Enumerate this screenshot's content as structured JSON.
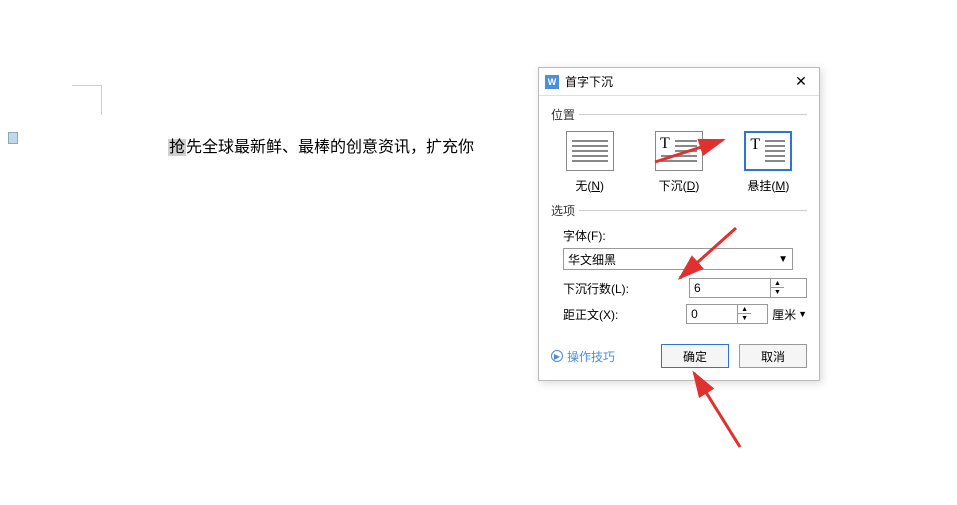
{
  "document": {
    "body_text": "抢先全球最新鲜、最棒的创意资讯，扩充你",
    "cursor_initial": "抢"
  },
  "dialog": {
    "title": "首字下沉",
    "icon_glyph": "W",
    "section_position": "位置",
    "section_options": "选项",
    "position_options": [
      {
        "label_prefix": "无(",
        "key": "N",
        "label_suffix": ")"
      },
      {
        "label_prefix": "下沉(",
        "key": "D",
        "label_suffix": ")"
      },
      {
        "label_prefix": "悬挂(",
        "key": "M",
        "label_suffix": ")"
      }
    ],
    "font_label": "字体(F):",
    "font_value": "华文细黑",
    "lines_label": "下沉行数(L):",
    "lines_value": "6",
    "distance_label": "距正文(X):",
    "distance_value": "0",
    "distance_unit": "厘米",
    "tips_label": "操作技巧",
    "ok_label": "确定",
    "cancel_label": "取消"
  }
}
